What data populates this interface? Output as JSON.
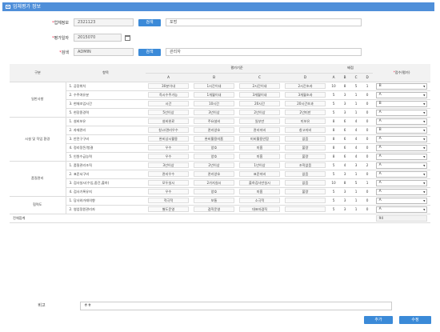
{
  "title": "업체평가 정보",
  "fields": {
    "company_label": "업체정보",
    "company_code": "2321123",
    "search1": "검색",
    "company_name": "포멍",
    "date_label": "평가일자",
    "date": "2015070",
    "auth_label": "검색",
    "auth_id": "ADMIN",
    "search2": "검색",
    "auth_name": "관리자"
  },
  "header": {
    "col_group": "구분",
    "col_item": "항목",
    "col_criteria": "평가기준",
    "col_weight": "배점",
    "col_score": "점수(평가)",
    "crit": [
      "A",
      "B",
      "C",
      "D"
    ],
    "wt": [
      "A",
      "B",
      "C",
      "D"
    ]
  },
  "groups": [
    {
      "name": "일반사항",
      "rows": [
        {
          "item": "1. 공장위치",
          "c": [
            "30분이내",
            "1시간이내",
            "2시간이내",
            "2시간초과"
          ],
          "w": [
            "10",
            "8",
            "5",
            "1"
          ],
          "s": "B"
        },
        {
          "item": "2. 수주여유분",
          "c": [
            "즉시수주가능",
            "1개월이내",
            "3개월이내",
            "3개월초과"
          ],
          "w": [
            "5",
            "3",
            "1",
            "0"
          ],
          "s": "A"
        },
        {
          "item": "3. 현재조업시간",
          "c": [
            "시간",
            "10시간",
            "20시간",
            "20시간초과"
          ],
          "w": [
            "5",
            "3",
            "1",
            "0"
          ],
          "s": "B"
        },
        {
          "item": "5. 현장종경력",
          "c": [
            "5년이상",
            "3년이상",
            "2년이상",
            "2년미만"
          ],
          "w": [
            "5",
            "3",
            "1",
            "0"
          ],
          "s": "A"
        }
      ]
    },
    {
      "name": "시설 및 작업 환경",
      "rows": [
        {
          "item": "1. 설비보유",
          "c": [
            "설비완료",
            "주요설비",
            "일부만",
            "미보유"
          ],
          "w": [
            "8",
            "6",
            "4",
            "0"
          ],
          "s": "A"
        },
        {
          "item": "2. 자재관리",
          "c": [
            "창고/관리우수",
            "관리양호",
            "관리미비",
            "창고미비"
          ],
          "w": [
            "8",
            "6",
            "4",
            "0"
          ],
          "s": "B"
        },
        {
          "item": "3. 안전구구비",
          "c": [
            "완비상시활용",
            "완비활용미흡",
            "미비활용안함",
            "없음"
          ],
          "w": [
            "8",
            "6",
            "4",
            "0"
          ],
          "s": "A"
        },
        {
          "item": "4. 정리정돈/청결",
          "c": [
            "우수",
            "양호",
            "미흡",
            "불량"
          ],
          "w": [
            "8",
            "6",
            "4",
            "0"
          ],
          "s": "A"
        },
        {
          "item": "5. 인원수급능력",
          "c": [
            "우수",
            "양호",
            "미흡",
            "불량"
          ],
          "w": [
            "8",
            "6",
            "4",
            "0"
          ],
          "s": "A"
        }
      ]
    },
    {
      "name": "품질관리",
      "rows": [
        {
          "item": "1. 품질관리조직",
          "c": [
            "3년이상",
            "2년이상",
            "1년이상",
            "조직없음"
          ],
          "w": [
            "5",
            "4",
            "3",
            "2"
          ],
          "s": "A"
        },
        {
          "item": "2. 표준서구비",
          "c": [
            "관리우수",
            "관리양호",
            "표준미비",
            "없음"
          ],
          "w": [
            "5",
            "3",
            "1",
            "0"
          ],
          "s": "A"
        },
        {
          "item": "3. 검사실시(수입,중간,출하)",
          "c": [
            "모두실시",
            "2가지실시",
            "출하검사만실시",
            "없음"
          ],
          "w": [
            "10",
            "8",
            "5",
            "1"
          ],
          "s": "A"
        },
        {
          "item": "4. 검사기록유지",
          "c": [
            "우수",
            "양호",
            "미흡",
            "불량"
          ],
          "w": [
            "5",
            "3",
            "1",
            "0"
          ],
          "s": "A"
        }
      ]
    },
    {
      "name": "협력도",
      "rows": [
        {
          "item": "1. 당사와거래의향",
          "c": [
            "적극적",
            "보통",
            "소극적",
            ""
          ],
          "w": [
            "5",
            "3",
            "1",
            "0"
          ],
          "s": "A"
        },
        {
          "item": "2. 영업정원관리자",
          "c": [
            "별도운영",
            "겸직운영",
            "대표자겸직",
            ""
          ],
          "w": [
            "5",
            "3",
            "1",
            "0"
          ],
          "s": "A"
        }
      ]
    }
  ],
  "total_label": "전체합계",
  "total": "94",
  "note_label": "비고",
  "note": "ㅎㅎ",
  "buttons": {
    "add": "추가",
    "edit": "수정"
  }
}
